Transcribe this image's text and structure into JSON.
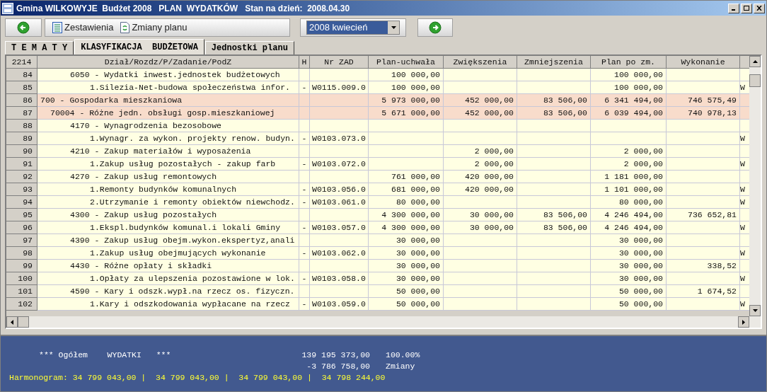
{
  "window": {
    "title": "Gmina WILKOWYJE  Budżet 2008   PLAN  WYDATKÓW   Stan na dzień:  2008.04.30"
  },
  "toolbar": {
    "buttons": [
      {
        "label": "Zestawienia",
        "kind": "list"
      },
      {
        "label": "Zmiany planu",
        "kind": "changes"
      }
    ],
    "period": {
      "value": "2008 kwiecień"
    }
  },
  "tabs": [
    {
      "label": "T E M A T Y",
      "selected": false
    },
    {
      "label": "KLASYFIKACJA  BUDŻETOWA",
      "selected": true
    },
    {
      "label": "Jednostki planu",
      "selected": false
    }
  ],
  "table": {
    "count": "2214",
    "columns": [
      "Dział/Rozdz/P/Zadanie/PodZ",
      "H",
      "Nr ZAD",
      "Plan-uchwała",
      "Zwiększenia",
      "Zmniejszenia",
      "Plan po zm.",
      "Wykonanie"
    ],
    "rows": [
      {
        "number": "84",
        "kind": "paragraf",
        "name": "6050 - Wydatki inwest.jednostek budżetowych",
        "plan": "100 000,00",
        "plan_po_zm": "100 000,00"
      },
      {
        "number": "85",
        "kind": "zadanie",
        "name": "1.Silezia-Net-budowa społeczeństwa infor.",
        "h": "-",
        "nr_zad": "W0115.009.0",
        "plan": "100 000,00",
        "plan_po_zm": "100 000,00",
        "column_10": "W"
      },
      {
        "number": "86",
        "kind": "dzial",
        "name": "700 - Gospodarka mieszkaniowa",
        "plan": "5 973 000,00",
        "zwiekszenia": "452 000,00",
        "zmniejszenia": "83 506,00",
        "plan_po_zm": "6 341 494,00",
        "wykonanie": "746 575,49"
      },
      {
        "number": "87",
        "kind": "rozdzial",
        "name": "70004 - Różne jedn. obsługi gosp.mieszkaniowej",
        "plan": "5 671 000,00",
        "zwiekszenia": "452 000,00",
        "zmniejszenia": "83 506,00",
        "plan_po_zm": "6 039 494,00",
        "wykonanie": "740 978,13"
      },
      {
        "number": "88",
        "kind": "paragraf",
        "name": "4170 - Wynagrodzenia bezosobowe"
      },
      {
        "number": "89",
        "kind": "zadanie",
        "name": "1.Wynagr. za wykon. projekty renow. budyn.",
        "h": "-",
        "nr_zad": "W0103.073.0",
        "column_10": "W"
      },
      {
        "number": "90",
        "kind": "paragraf",
        "name": "4210 - Zakup materiałów i wyposażenia",
        "zwiekszenia": "2 000,00",
        "plan_po_zm": "2 000,00"
      },
      {
        "number": "91",
        "kind": "zadanie",
        "name": "1.Zakup usług pozostałych - zakup farb",
        "h": "-",
        "nr_zad": "W0103.072.0",
        "zwiekszenia": "2 000,00",
        "plan_po_zm": "2 000,00",
        "column_10": "W"
      },
      {
        "number": "92",
        "kind": "paragraf",
        "name": "4270 - Zakup usług remontowych",
        "plan": "761 000,00",
        "zwiekszenia": "420 000,00",
        "plan_po_zm": "1 181 000,00"
      },
      {
        "number": "93",
        "kind": "zadanie",
        "name": "1.Remonty budynków komunalnych",
        "h": "-",
        "nr_zad": "W0103.056.0",
        "plan": "681 000,00",
        "zwiekszenia": "420 000,00",
        "plan_po_zm": "1 101 000,00",
        "column_10": "W"
      },
      {
        "number": "94",
        "kind": "zadanie",
        "name": "2.Utrzymanie i remonty obiektów niewchodz.",
        "h": "-",
        "nr_zad": "W0103.061.0",
        "plan": "80 000,00",
        "plan_po_zm": "80 000,00",
        "column_10": "W"
      },
      {
        "number": "95",
        "kind": "paragraf",
        "name": "4300 - Zakup usług pozostałych",
        "plan": "4 300 000,00",
        "zwiekszenia": "30 000,00",
        "zmniejszenia": "83 506,00",
        "plan_po_zm": "4 246 494,00",
        "wykonanie": "736 652,81"
      },
      {
        "number": "96",
        "kind": "zadanie",
        "name": "1.Ekspl.budynków komunal.i lokali Gminy",
        "h": "-",
        "nr_zad": "W0103.057.0",
        "plan": "4 300 000,00",
        "zwiekszenia": "30 000,00",
        "zmniejszenia": "83 506,00",
        "plan_po_zm": "4 246 494,00",
        "column_10": "W"
      },
      {
        "number": "97",
        "kind": "paragraf",
        "name": "4390 - Zakup usług obejm.wykon.ekspertyz,anali",
        "plan": "30 000,00",
        "plan_po_zm": "30 000,00"
      },
      {
        "number": "98",
        "kind": "zadanie",
        "name": "1.Zakup usług obejmujących wykonanie",
        "h": "-",
        "nr_zad": "W0103.062.0",
        "plan": "30 000,00",
        "plan_po_zm": "30 000,00",
        "column_10": "W"
      },
      {
        "number": "99",
        "kind": "paragraf",
        "name": "4430 - Różne opłaty i składki",
        "plan": "30 000,00",
        "plan_po_zm": "30 000,00",
        "wykonanie": "338,52"
      },
      {
        "number": "100",
        "kind": "zadanie",
        "name": "1.Opłaty za ulepszenia pozostawione w lok.",
        "h": "-",
        "nr_zad": "W0103.058.0",
        "plan": "30 000,00",
        "plan_po_zm": "30 000,00",
        "column_10": "W"
      },
      {
        "number": "101",
        "kind": "paragraf",
        "name": "4590 - Kary i odszk.wypł.na rzecz os. fizyczn.",
        "plan": "50 000,00",
        "plan_po_zm": "50 000,00",
        "wykonanie": "1 674,52"
      },
      {
        "number": "102",
        "kind": "zadanie",
        "name": "1.Kary i odszkodowania wypłacane na rzecz",
        "h": "-",
        "nr_zad": "W0103.059.0",
        "plan": "50 000,00",
        "plan_po_zm": "50 000,00",
        "column_10": "W"
      }
    ]
  },
  "summary": {
    "lines": [
      {
        "label": "*** Ogółem    WYDATKI   ***",
        "amount": "139 195 373,00",
        "note": "100.00%"
      },
      {
        "amount": "-3 786 758,00",
        "note": "Zmiany"
      }
    ],
    "harmonogram": "Harmonogram: 34 799 043,00 |  34 799 043,00 |  34 799 043,00 |  34 798 244,00"
  }
}
